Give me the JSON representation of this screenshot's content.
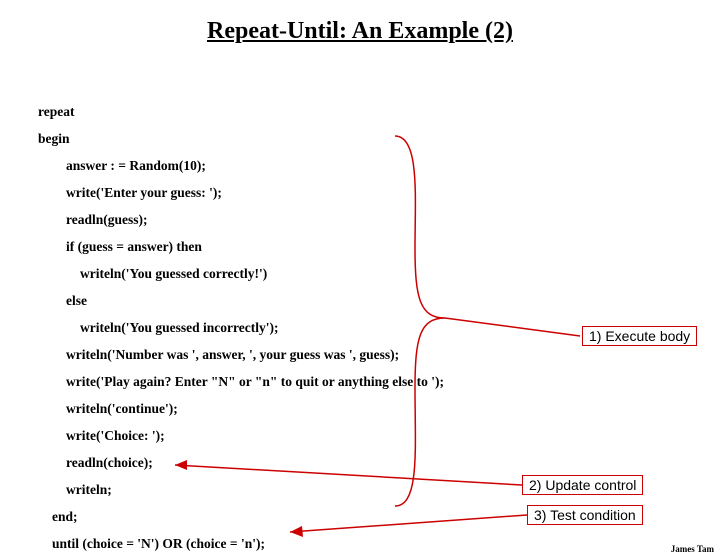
{
  "title": "Repeat-Until: An Example (2)",
  "code": {
    "l1": "repeat",
    "l2": "begin",
    "l3": "answer : = Random(10);",
    "l4": "write('Enter your guess: ');",
    "l5": "readln(guess);",
    "l6": "if (guess = answer) then",
    "l7": "writeln('You guessed correctly!')",
    "l8": "else",
    "l9": "writeln('You guessed incorrectly');",
    "l10": "writeln('Number was ', answer, ', your guess was ', guess);",
    "l11": "write('Play again? Enter \"N\" or \"n\" to quit or anything else to ');",
    "l12": "writeln('continue');",
    "l13": "write('Choice: ');",
    "l14": "readln(choice);",
    "l15": "writeln;",
    "l16": "end;",
    "l17": "until (choice = 'N') OR (choice = 'n');"
  },
  "callouts": {
    "c1": "1) Execute body",
    "c2": "2) Update control",
    "c3": "3) Test condition"
  },
  "footer": "James Tam"
}
